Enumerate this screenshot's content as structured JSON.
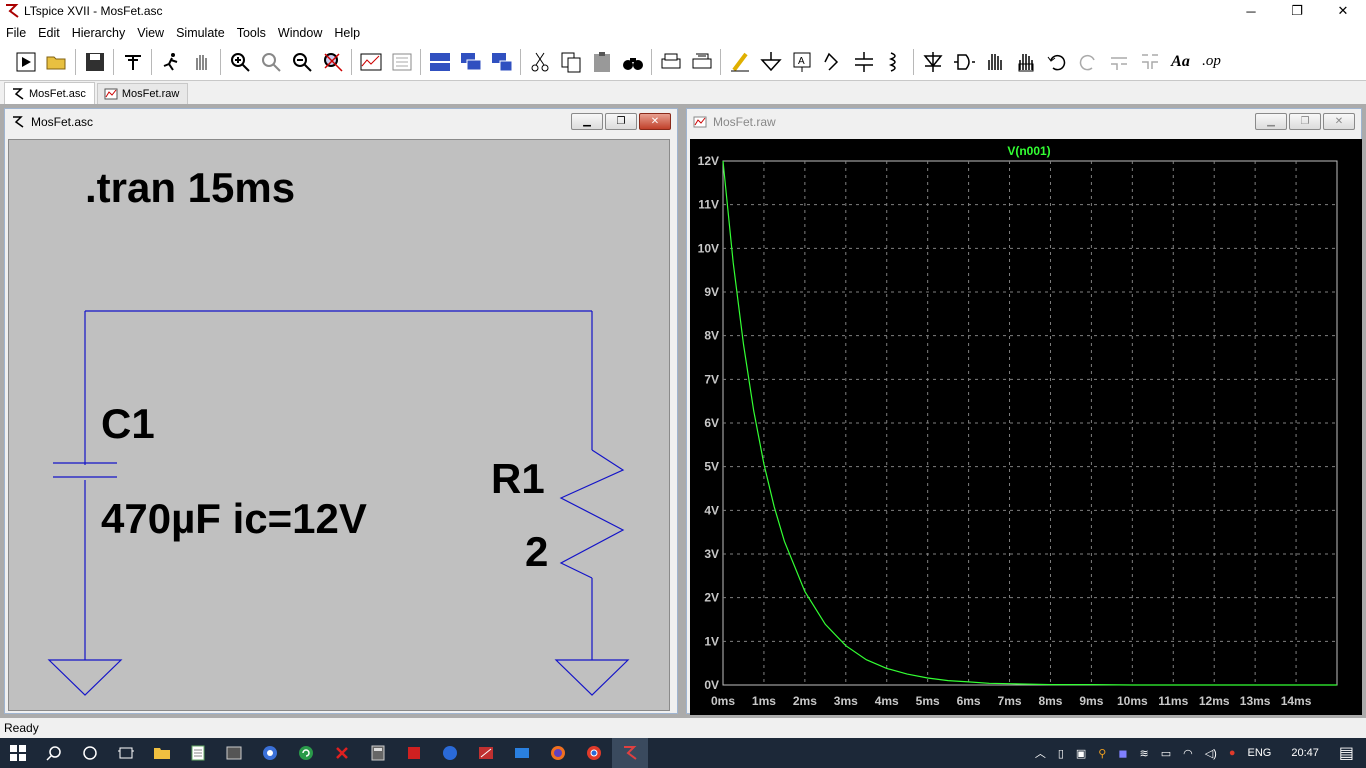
{
  "window": {
    "title": "LTspice XVII - MosFet.asc",
    "minimize": "─",
    "maximize": "❐",
    "close": "✕"
  },
  "menu": [
    {
      "label": "File"
    },
    {
      "label": "Edit"
    },
    {
      "label": "Hierarchy"
    },
    {
      "label": "View"
    },
    {
      "label": "Simulate"
    },
    {
      "label": "Tools"
    },
    {
      "label": "Window"
    },
    {
      "label": "Help"
    }
  ],
  "toolbar_icons": [
    "run-icon",
    "open-icon",
    "save-icon",
    "control-panel-icon",
    "halt-icon",
    "pan-hand-icon",
    "zoom-in-icon",
    "zoom-pan-icon",
    "zoom-out-icon",
    "zoom-fit-icon",
    "autorange-icon",
    "waveform-icon",
    "tile-horizontal-icon",
    "cascade-icon",
    "tile-vertical-icon",
    "cut-icon",
    "copy-icon",
    "paste-icon",
    "find-icon",
    "print-icon",
    "print-setup-icon",
    "draw-wire-icon",
    "ground-icon",
    "label-net-icon",
    "resistor-icon",
    "capacitor-icon",
    "inductor-icon",
    "diode-icon",
    "component-icon",
    "move-icon",
    "drag-icon",
    "undo-icon",
    "redo-icon",
    "rotate-icon",
    "mirror-icon",
    "text-icon",
    "spice-directive-icon"
  ],
  "toolbar_text": {
    "text_tool": "Aa",
    "op_tool": ".op"
  },
  "tabs": [
    {
      "label": "MosFet.asc"
    },
    {
      "label": "MosFet.raw"
    }
  ],
  "schematic": {
    "window_title": "MosFet.asc",
    "directive": ".tran 15ms",
    "c1_name": "C1",
    "c1_value": "470µF ic=12V",
    "r1_name": "R1",
    "r1_value": "2",
    "wire_color": "#1414c8"
  },
  "plot": {
    "window_title": "MosFet.raw",
    "trace_color": "#33ff33",
    "grid_color": "#808080"
  },
  "chart_data": {
    "type": "line",
    "title": "",
    "series": [
      {
        "name": "V(n001)",
        "x": [
          0,
          0.25,
          0.5,
          0.75,
          1,
          1.25,
          1.5,
          2,
          2.5,
          3,
          3.5,
          4,
          4.5,
          5,
          5.5,
          6,
          6.5,
          7,
          8,
          9,
          10,
          11,
          12,
          13,
          14,
          15
        ],
        "y": [
          12,
          9.67,
          7.8,
          6.28,
          5.06,
          4.08,
          3.29,
          2.14,
          1.39,
          0.9,
          0.58,
          0.38,
          0.25,
          0.16,
          0.1,
          0.07,
          0.04,
          0.03,
          0.01,
          0.01,
          0,
          0,
          0,
          0,
          0,
          0
        ]
      }
    ],
    "x_ticks": [
      "0ms",
      "1ms",
      "2ms",
      "3ms",
      "4ms",
      "5ms",
      "6ms",
      "7ms",
      "8ms",
      "9ms",
      "10ms",
      "11ms",
      "12ms",
      "13ms",
      "14ms"
    ],
    "y_ticks": [
      "0V",
      "1V",
      "2V",
      "3V",
      "4V",
      "5V",
      "6V",
      "7V",
      "8V",
      "9V",
      "10V",
      "11V",
      "12V"
    ],
    "xlim": [
      0,
      15
    ],
    "ylim": [
      0,
      12
    ],
    "grid": true
  },
  "status": {
    "text": "Ready"
  },
  "taskbar": {
    "lang": "ENG",
    "time": "20:47"
  }
}
